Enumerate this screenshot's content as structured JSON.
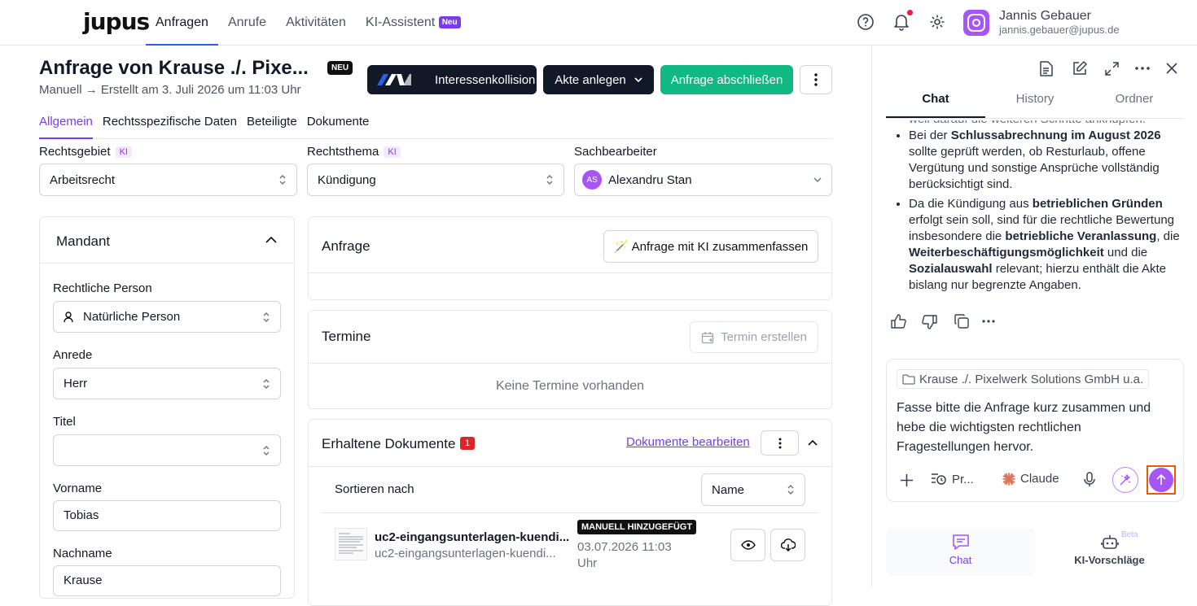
{
  "app": {
    "logo": "jupus"
  },
  "nav": {
    "tabs": [
      {
        "label": "Anfragen"
      },
      {
        "label": "Anrufe"
      },
      {
        "label": "Aktivitäten"
      },
      {
        "label": "KI-Assistent"
      }
    ],
    "ki_badge": "Neu"
  },
  "user": {
    "name": "Jannis Gebauer",
    "email": "jannis.gebauer@jupus.de"
  },
  "header": {
    "title": "Anfrage von Krause ./. Pixe...",
    "badge": "NEU",
    "subtitle": "Manuell → Erstellt am 3. Juli 2026 um 11:03 Uhr",
    "buttons": {
      "conflict": "Interessenkollision",
      "create_file": "Akte anlegen",
      "close_request": "Anfrage abschließen"
    }
  },
  "subtabs": [
    {
      "label": "Allgemein"
    },
    {
      "label": "Rechtsspezifische Daten"
    },
    {
      "label": "Beteiligte"
    },
    {
      "label": "Dokumente"
    }
  ],
  "fields": {
    "rechtsgebiet": {
      "label": "Rechtsgebiet",
      "ki": "KI",
      "value": "Arbeitsrecht"
    },
    "rechtsthema": {
      "label": "Rechtsthema",
      "ki": "KI",
      "value": "Kündigung"
    },
    "sachbearbeiter": {
      "label": "Sachbearbeiter",
      "initials": "AS",
      "value": "Alexandru Stan"
    }
  },
  "mandant": {
    "title": "Mandant",
    "rechtliche_person": {
      "label": "Rechtliche Person",
      "value": "Natürliche Person"
    },
    "anrede": {
      "label": "Anrede",
      "value": "Herr"
    },
    "titel": {
      "label": "Titel",
      "value": ""
    },
    "vorname": {
      "label": "Vorname",
      "value": "Tobias"
    },
    "nachname": {
      "label": "Nachname",
      "value": "Krause"
    }
  },
  "anfrage": {
    "title": "Anfrage",
    "summarize_button": "🪄 Anfrage mit KI zusammenfassen"
  },
  "termine": {
    "title": "Termine",
    "create_button": "Termin erstellen",
    "empty": "Keine Termine vorhanden"
  },
  "dokumente": {
    "title": "Erhaltene Dokumente",
    "count": "1",
    "edit_link": "Dokumente bearbeiten",
    "sort_label": "Sortieren nach",
    "sort_value": "Name",
    "items": [
      {
        "name": "uc2-eingangsunterlagen-kuendi...",
        "subname": "uc2-eingangsunterlagen-kuendi...",
        "badge": "MANUELL HINZUGEFÜGT",
        "date": "03.07.2026 11:03",
        "date2": "Uhr"
      }
    ]
  },
  "panel": {
    "tabs": [
      {
        "label": "Chat"
      },
      {
        "label": "History"
      },
      {
        "label": "Ordner"
      }
    ],
    "cut_line": "weil darauf die weiteren Schritte anknüpfen.",
    "bullets": [
      {
        "parts": [
          {
            "t": "Bei der "
          },
          {
            "t": "Schlussabrechnung im August 2026",
            "b": true
          },
          {
            "t": " sollte geprüft werden, ob Resturlaub, offene Vergütung und sonstige Ansprüche vollständig berücksichtigt sind."
          }
        ]
      },
      {
        "parts": [
          {
            "t": "Da die Kündigung aus "
          },
          {
            "t": "betrieblichen Gründen",
            "b": true
          },
          {
            "t": " erfolgt sein soll, sind für die rechtliche Bewertung insbesondere die "
          },
          {
            "t": "betriebliche Veranlassung",
            "b": true
          },
          {
            "t": ", die "
          },
          {
            "t": "Weiterbeschäftigungsmöglichkeit",
            "b": true
          },
          {
            "t": " und die "
          },
          {
            "t": "Sozialauswahl",
            "b": true
          },
          {
            "t": " relevant; hierzu enthält die Akte bislang nur begrenzte Angaben."
          }
        ]
      }
    ],
    "context_chip": "Krause ./. Pixelwerk Solutions GmbH u.a.",
    "prompt": "Fasse bitte die Anfrage kurz zusammen und hebe die wichtigsten rechtlichen Fragestellungen hervor.",
    "prompts_button": "Pr...",
    "model": "Claude",
    "bottom": [
      {
        "label": "Chat"
      },
      {
        "label": "KI-Vorschläge"
      }
    ],
    "beta": "Beta"
  },
  "colors": {
    "accent": "#7c3aed",
    "green": "#10b981",
    "dark": "#111827",
    "send_outline": "#ea580c"
  }
}
